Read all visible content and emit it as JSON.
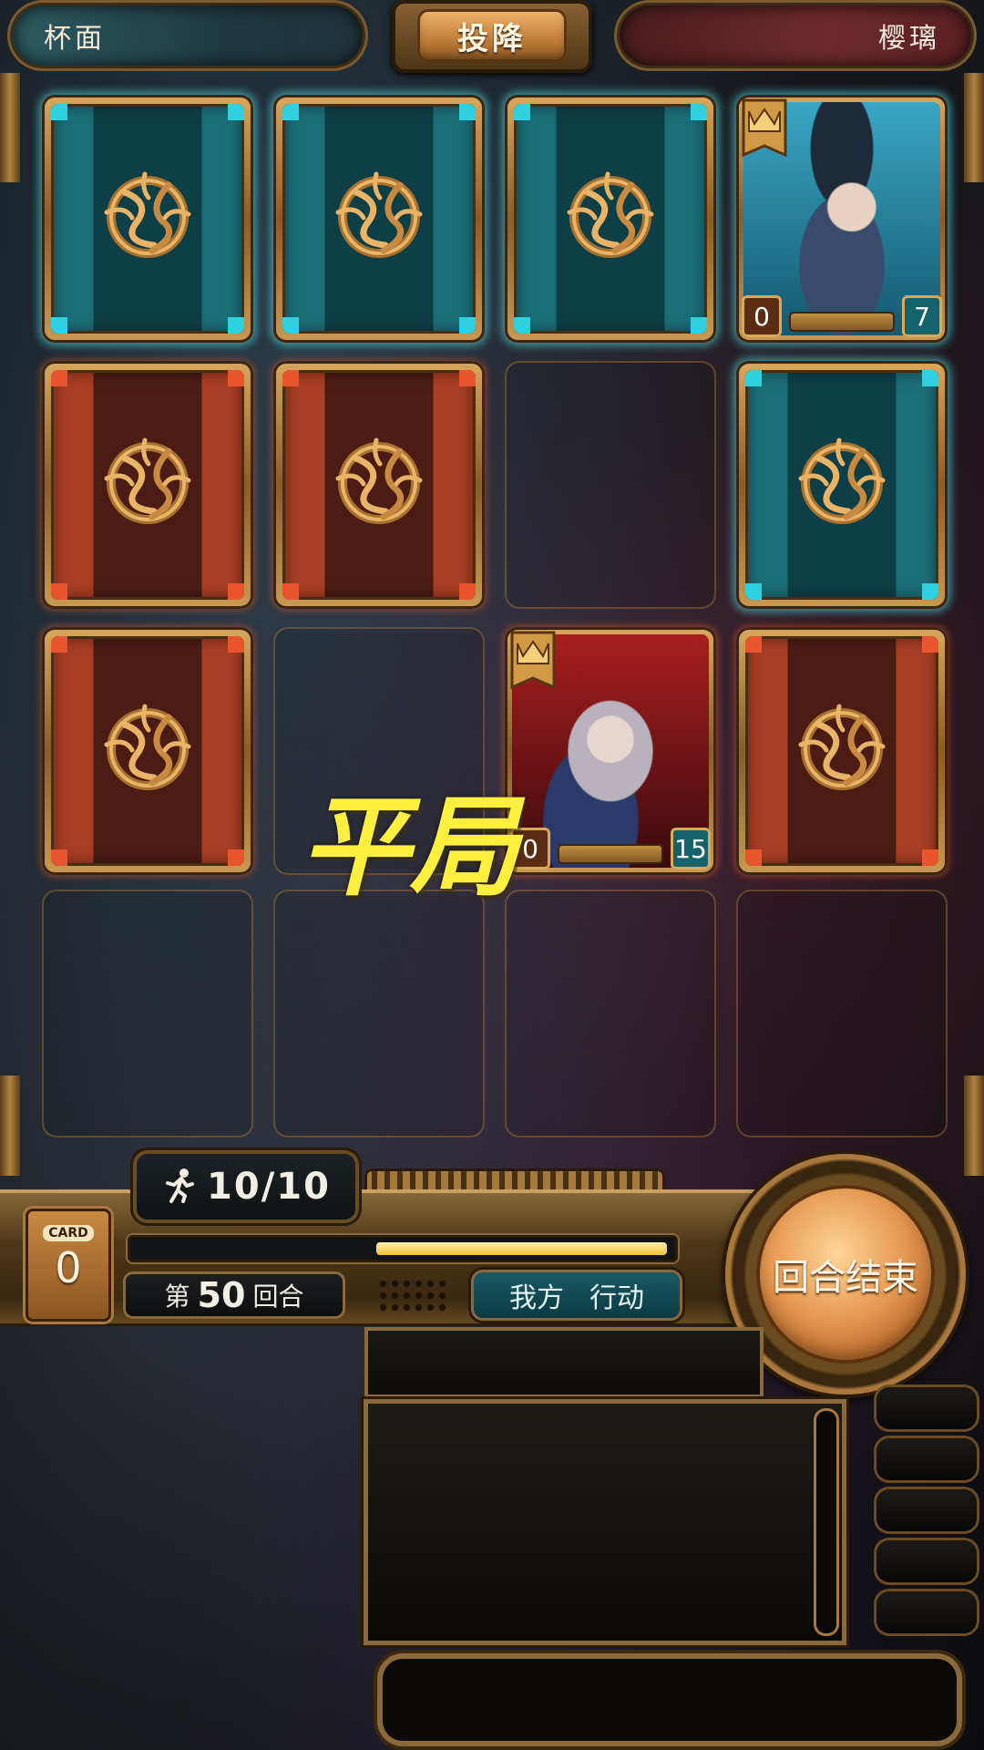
{
  "top_bar": {
    "player_left_name": "杯面",
    "surrender_label": "投降",
    "player_right_name": "樱璃"
  },
  "board": {
    "cards": [
      {
        "slot": "r1c1",
        "kind": "card-back",
        "color": "teal"
      },
      {
        "slot": "r1c2",
        "kind": "card-back",
        "color": "teal"
      },
      {
        "slot": "r1c3",
        "kind": "card-back",
        "color": "teal"
      },
      {
        "slot": "r1c4",
        "kind": "character",
        "color": "teal",
        "attack": "0",
        "health": "7"
      },
      {
        "slot": "r2c1",
        "kind": "card-back",
        "color": "red"
      },
      {
        "slot": "r2c2",
        "kind": "card-back",
        "color": "red"
      },
      {
        "slot": "r2c3",
        "kind": "empty"
      },
      {
        "slot": "r2c4",
        "kind": "card-back",
        "color": "teal"
      },
      {
        "slot": "r3c1",
        "kind": "card-back",
        "color": "red"
      },
      {
        "slot": "r3c2",
        "kind": "empty"
      },
      {
        "slot": "r3c3",
        "kind": "character",
        "color": "red",
        "attack": "0",
        "health": "15"
      },
      {
        "slot": "r3c4",
        "kind": "card-back",
        "color": "red"
      },
      {
        "slot": "r4c1",
        "kind": "empty"
      },
      {
        "slot": "r4c2",
        "kind": "empty"
      },
      {
        "slot": "r4c3",
        "kind": "empty"
      },
      {
        "slot": "r4c4",
        "kind": "empty"
      }
    ],
    "result_text": "平局"
  },
  "hud": {
    "energy_icon": "running-man-icon",
    "energy": "10/10",
    "card_tag": "CARD",
    "card_count": "0",
    "progress_fraction": 0.55,
    "turn_prefix": "第",
    "turn_number": "50",
    "turn_suffix": "回合",
    "phase_side": "我方",
    "phase_action": "行动",
    "end_turn_label": "回合结束"
  },
  "colors": {
    "teal_accent": "#2fd0e0",
    "red_accent": "#e8552c",
    "brass": "#b08440",
    "result_yellow": "#ffef3e"
  }
}
